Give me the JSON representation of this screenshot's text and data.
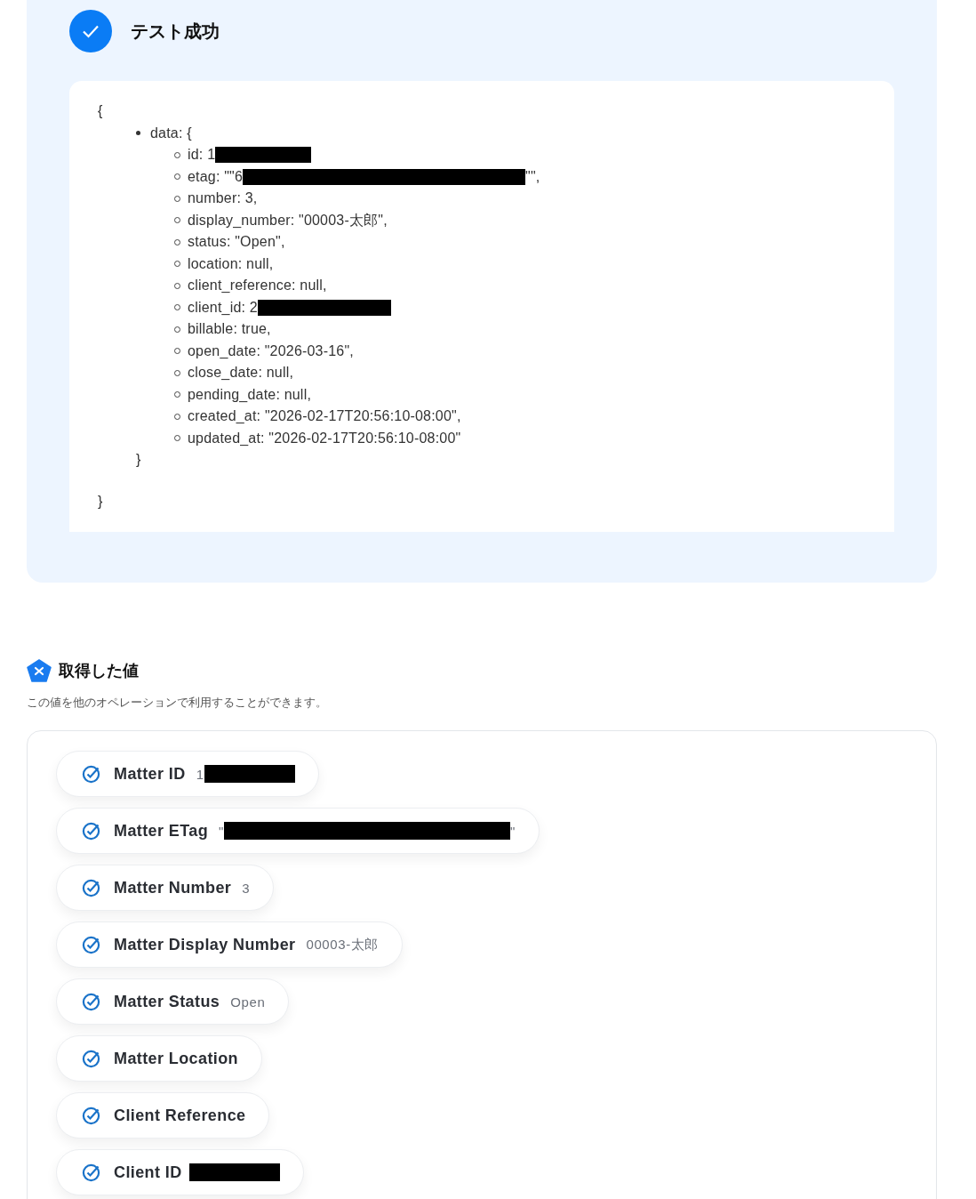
{
  "result": {
    "title": "テスト成功",
    "open_brace": "{",
    "close_brace": "}",
    "data_key": "data: {",
    "data_close": "}",
    "fields": [
      {
        "text": "id: 1",
        "redacted": true
      },
      {
        "text": "etag: \"\"6",
        "redacted": true,
        "tail": "\"\","
      },
      {
        "text": "number: 3,"
      },
      {
        "text": "display_number: \"00003-太郎\","
      },
      {
        "text": "status: \"Open\","
      },
      {
        "text": "location: null,"
      },
      {
        "text": "client_reference: null,"
      },
      {
        "text": "client_id: 2",
        "redacted": true
      },
      {
        "text": "billable: true,"
      },
      {
        "text": "open_date: \"2026-03-16\","
      },
      {
        "text": "close_date: null,"
      },
      {
        "text": "pending_date: null,"
      },
      {
        "text": "created_at: \"2026-02-17T20:56:10-08:00\","
      },
      {
        "text": "updated_at: \"2026-02-17T20:56:10-08:00\""
      }
    ]
  },
  "values": {
    "title": "取得した値",
    "description": "この値を他のオペレーションで利用することができます。",
    "items": [
      {
        "label": "Matter ID",
        "value": "1",
        "redacted": true
      },
      {
        "label": "Matter ETag",
        "value": "\"",
        "redacted": true,
        "tail": "\""
      },
      {
        "label": "Matter Number",
        "value": "3"
      },
      {
        "label": "Matter Display Number",
        "value": "00003-太郎"
      },
      {
        "label": "Matter Status",
        "value": "Open"
      },
      {
        "label": "Matter Location"
      },
      {
        "label": "Client Reference"
      },
      {
        "label": "Client ID",
        "redacted": true
      }
    ]
  }
}
